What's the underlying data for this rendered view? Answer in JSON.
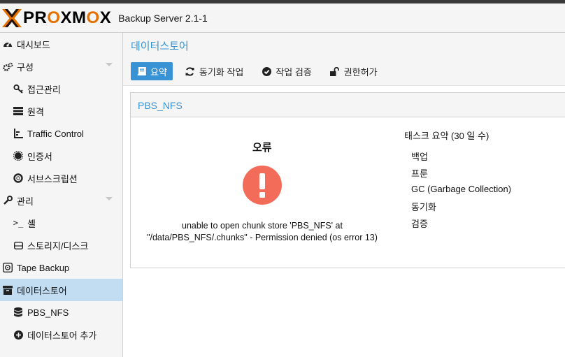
{
  "header": {
    "logo_text_1": "PR",
    "logo_o1": "O",
    "logo_text_2": "XM",
    "logo_o2": "O",
    "logo_text_3": "X",
    "product_title": "Backup Server 2.1-1"
  },
  "sidebar": {
    "items": [
      {
        "label": "대시보드",
        "icon": "dashboard-icon"
      },
      {
        "label": "구성",
        "icon": "gears-icon"
      },
      {
        "label": "접근관리",
        "icon": "key-icon"
      },
      {
        "label": "원격",
        "icon": "server-icon"
      },
      {
        "label": "Traffic Control",
        "icon": "chart-icon"
      },
      {
        "label": "인증서",
        "icon": "certificate-icon"
      },
      {
        "label": "서브스크립션",
        "icon": "lifebuoy-icon"
      },
      {
        "label": "관리",
        "icon": "wrench-icon"
      },
      {
        "label": "셸",
        "icon": "terminal-icon"
      },
      {
        "label": "스토리지/디스크",
        "icon": "hdd-icon"
      },
      {
        "label": "Tape Backup",
        "icon": "tape-icon"
      },
      {
        "label": "데이터스토어",
        "icon": "archive-icon"
      },
      {
        "label": "PBS_NFS",
        "icon": "database-icon"
      },
      {
        "label": "데이터스토어 추가",
        "icon": "plus-circle-icon"
      }
    ],
    "selected_index": 11
  },
  "main": {
    "title": "데이터스토어",
    "tabs": [
      {
        "label": "요약",
        "icon": "book-icon",
        "active": true
      },
      {
        "label": "동기화 작업",
        "icon": "refresh-icon",
        "active": false
      },
      {
        "label": "작업 검증",
        "icon": "check-circle-icon",
        "active": false
      },
      {
        "label": "권한허가",
        "icon": "unlock-icon",
        "active": false
      }
    ],
    "panel_title": "PBS_NFS",
    "error": {
      "title": "오류",
      "icon": "exclamation-circle-icon",
      "color": "#f26c59",
      "message": "unable to open chunk store 'PBS_NFS' at \"/data/PBS_NFS/.chunks\" - Permission denied (os error 13)"
    },
    "tasks": {
      "title": "태스크 요약 (30 일 수)",
      "items": [
        "백업",
        "프룬",
        "GC (Garbage Collection)",
        "동기화",
        "검증"
      ]
    }
  },
  "colors": {
    "accent": "#3892d4",
    "selected_bg": "#c2ddf2",
    "brand_orange": "#e57000"
  }
}
